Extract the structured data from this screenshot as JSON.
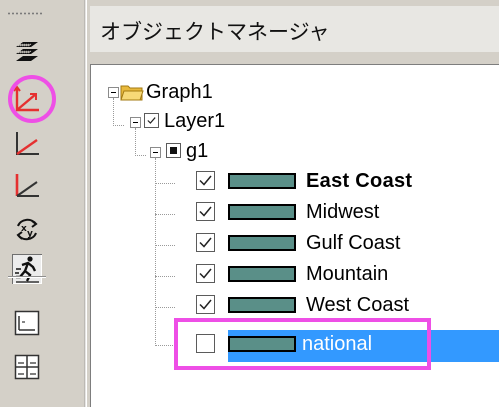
{
  "panel": {
    "title": "オブジェクトマネージャ"
  },
  "colors": {
    "accent_highlight": "#ee4fe6",
    "selection": "#3399ff",
    "swatch": "#5a8f88",
    "toolbar_red": "#e53030"
  },
  "toolbar": {
    "buttons": [
      {
        "icon": "stacked-layers-icon"
      },
      {
        "icon": "add-axes-icon",
        "highlighted": true
      },
      {
        "icon": "add-bottom-axis-icon"
      },
      {
        "icon": "add-right-axis-icon"
      },
      {
        "icon": "swap-xy-icon"
      },
      {
        "icon": "speed-mode-icon",
        "pressed": true
      },
      {
        "icon": "single-layout-icon"
      },
      {
        "icon": "grid-layout-icon"
      }
    ]
  },
  "tree": {
    "graph": {
      "label": "Graph1",
      "icon": "folder-icon",
      "expanded": true
    },
    "layer": {
      "label": "Layer1",
      "checked": true,
      "expanded": true
    },
    "group": {
      "label": "g1",
      "state": "partial",
      "expanded": true
    },
    "plots": [
      {
        "label": "East Coast",
        "checked": true,
        "bold": true,
        "selected": false
      },
      {
        "label": "Midwest",
        "checked": true,
        "bold": false,
        "selected": false
      },
      {
        "label": "Gulf Coast",
        "checked": true,
        "bold": false,
        "selected": false
      },
      {
        "label": "Mountain",
        "checked": true,
        "bold": false,
        "selected": false
      },
      {
        "label": "West Coast",
        "checked": true,
        "bold": false,
        "selected": false
      },
      {
        "label": "national",
        "checked": false,
        "bold": false,
        "selected": true
      }
    ]
  }
}
